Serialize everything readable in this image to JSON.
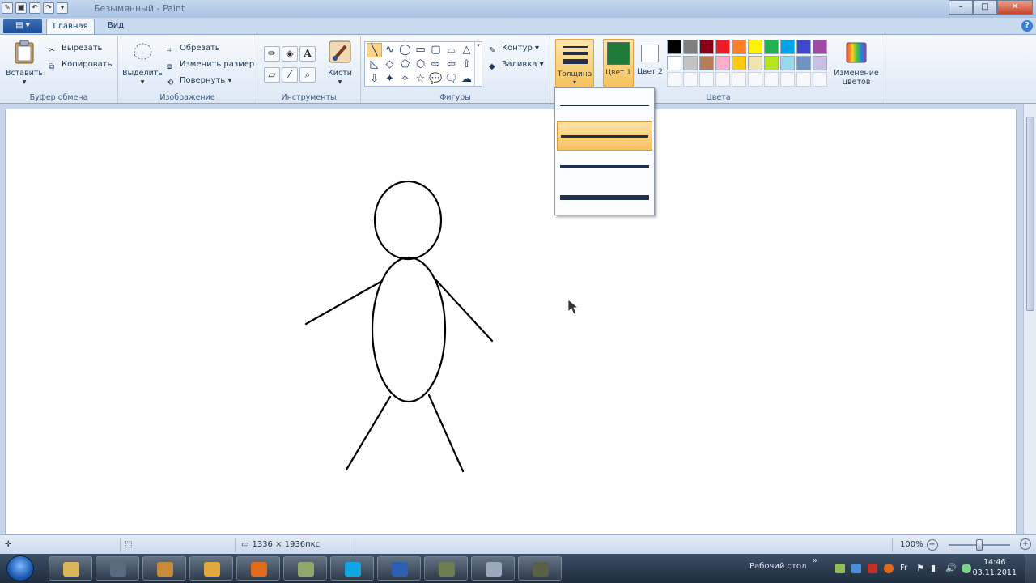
{
  "window": {
    "title": "Безымянный - Paint",
    "buttons": {
      "minimize": "–",
      "maximize": "□",
      "close": "✕"
    }
  },
  "tabs": {
    "app_menu": "▤ ▾",
    "home": "Главная",
    "view": "Вид",
    "help": "?"
  },
  "ribbon": {
    "clipboard": {
      "label": "Буфер обмена",
      "paste": "Вставить",
      "cut": "Вырезать",
      "copy": "Копировать"
    },
    "image": {
      "label": "Изображение",
      "select": "Выделить",
      "crop": "Обрезать",
      "resize": "Изменить размер",
      "rotate": "Повернуть ▾"
    },
    "tools": {
      "label": "Инструменты",
      "text_tool": "A",
      "brushes": "Кисти"
    },
    "shapes": {
      "label": "Фигуры",
      "outline": "Контур ▾",
      "fill": "Заливка ▾",
      "glyphs": [
        "╲",
        "∿",
        "◯",
        "▭",
        "▢",
        "⌓",
        "△",
        "◺",
        "◇",
        "⬠",
        "⬡",
        "⇨",
        "⇦",
        "⇧",
        "⇩",
        "✦",
        "✧",
        "☆",
        "💬",
        "🗨",
        "☁",
        "▾"
      ]
    },
    "thickness": {
      "label": "Толщина"
    },
    "color1": {
      "label": "Цвет 1",
      "value": "#1f7a3a"
    },
    "color2": {
      "label": "Цвет 2",
      "value": "#ffffff"
    },
    "colors": {
      "label": "Цвета",
      "edit": "Изменение цветов",
      "row1": [
        "#000000",
        "#7f7f7f",
        "#880015",
        "#ed1c24",
        "#ff7f27",
        "#fff200",
        "#22b14c",
        "#00a2e8",
        "#3f48cc",
        "#a349a4"
      ],
      "row2": [
        "#ffffff",
        "#c3c3c3",
        "#b97a57",
        "#ffaec9",
        "#ffc90e",
        "#efe4b0",
        "#b5e61d",
        "#99d9ea",
        "#7092be",
        "#c8bfe7"
      ]
    }
  },
  "thickness_menu": {
    "selected_index": 1,
    "line_widths": [
      1,
      3,
      4,
      6
    ]
  },
  "status": {
    "canvas_size": "1336 × 1936пкс",
    "zoom": "100%"
  },
  "taskbar": {
    "desktop_label": "Рабочий стол",
    "chevron": "»",
    "time": "14:46",
    "date": "03.11.2011",
    "apps": [
      {
        "name": "explorer",
        "color": "#d9b45a"
      },
      {
        "name": "media",
        "color": "#5a6b80"
      },
      {
        "name": "settings",
        "color": "#c88a3a"
      },
      {
        "name": "outlook",
        "color": "#e0a93a"
      },
      {
        "name": "firefox",
        "color": "#e26a1c"
      },
      {
        "name": "folder",
        "color": "#8fa86a"
      },
      {
        "name": "skype",
        "color": "#12a5e4"
      },
      {
        "name": "word",
        "color": "#2b5fb4"
      },
      {
        "name": "app",
        "color": "#6d7d4f"
      },
      {
        "name": "paint",
        "color": "#9aa9bc"
      },
      {
        "name": "tool",
        "color": "#5a6048"
      }
    ]
  }
}
